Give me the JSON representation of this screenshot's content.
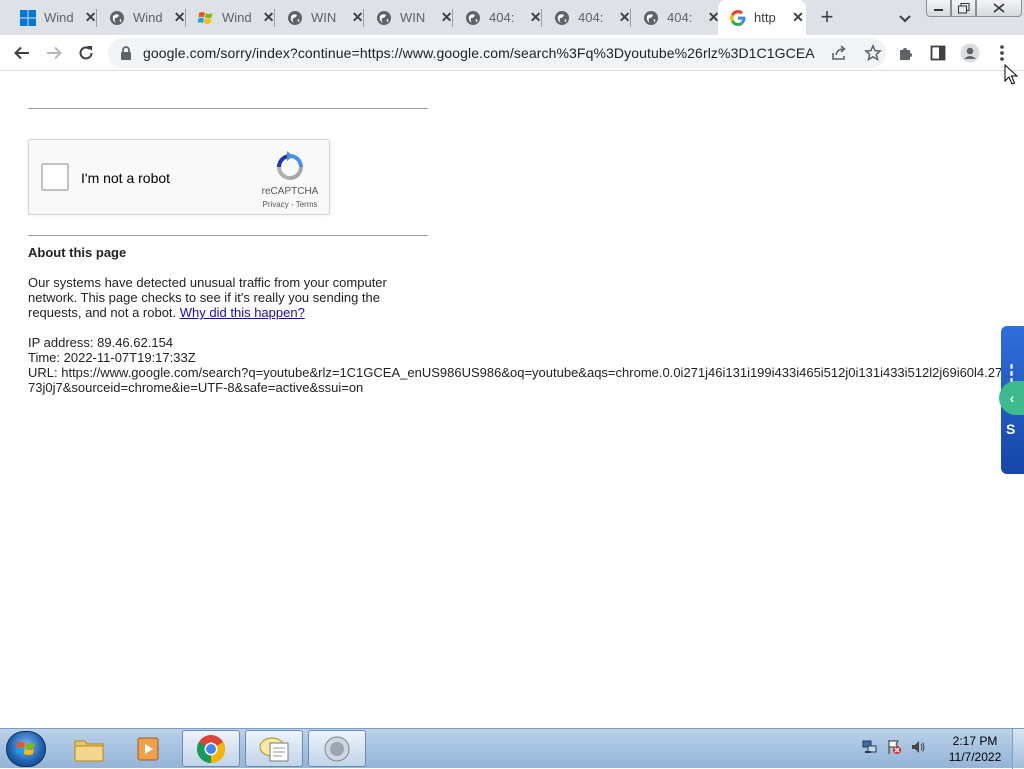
{
  "browser": {
    "tabs": [
      {
        "title": "Wind",
        "icon": "windows-icon"
      },
      {
        "title": "Wind",
        "icon": "globe-icon"
      },
      {
        "title": "Wind",
        "icon": "windows-flag-icon"
      },
      {
        "title": "WIN",
        "icon": "globe-icon"
      },
      {
        "title": "WIN",
        "icon": "globe-icon"
      },
      {
        "title": "404:",
        "icon": "globe-icon"
      },
      {
        "title": "404:",
        "icon": "globe-icon"
      },
      {
        "title": "404:",
        "icon": "globe-icon"
      },
      {
        "title": "http",
        "icon": "google-icon",
        "active": true
      }
    ],
    "tab_close_glyph": "✕",
    "new_tab_glyph": "+",
    "url": "google.com/sorry/index?continue=https://www.google.com/search%3Fq%3Dyoutube%26rlz%3D1C1GCEA..."
  },
  "page": {
    "captcha": {
      "label": "I'm not a robot",
      "brand": "reCAPTCHA",
      "links": "Privacy - Terms"
    },
    "about_heading": "About this page",
    "paragraph_text": "Our systems have detected unusual traffic from your computer network. This page checks to see if it's really you sending the requests, and not a robot. ",
    "paragraph_link": "Why did this happen?",
    "ip_line": "IP address: 89.46.62.154",
    "time_line": "Time: 2022-11-07T19:17:33Z",
    "url_line": "URL: https://www.google.com/search?q=youtube&rlz=1C1GCEA_enUS986US986&oq=youtube&aqs=chrome.0.0i271j46i131i199i433i465i512j0i131i433i512l2j69i60l4.2773j0j7&sourceid=chrome&ie=UTF-8&safe=active&ssui=on"
  },
  "taskbar": {
    "clock_time": "2:17 PM",
    "clock_date": "11/7/2022"
  },
  "colors": {
    "link": "#1a0dab",
    "tabstrip": "#dee1e6",
    "taskbar": "#a7c3e1"
  }
}
